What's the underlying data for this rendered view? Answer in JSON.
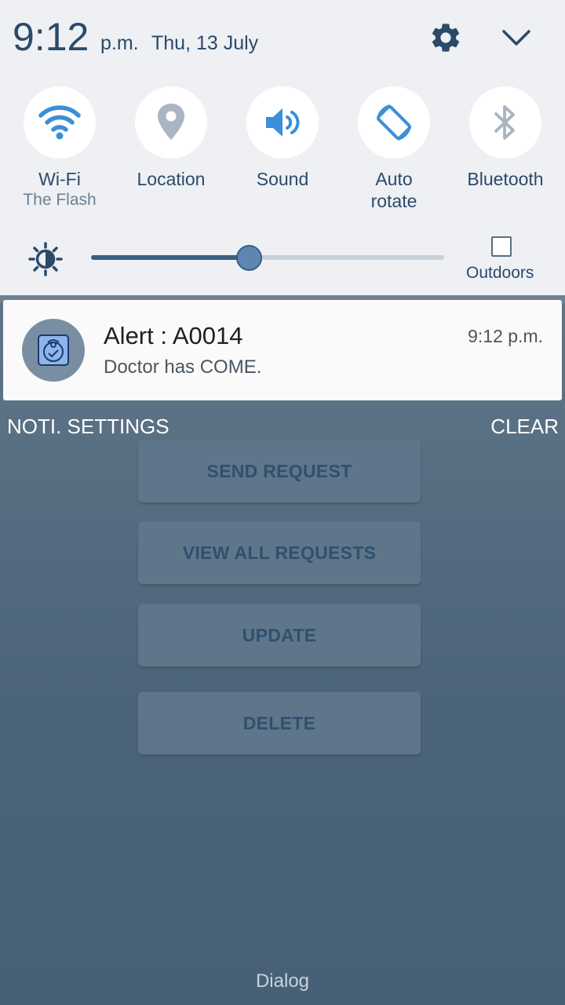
{
  "status": {
    "time": "9:12",
    "ampm": "p.m.",
    "date": "Thu, 13 July"
  },
  "quick_settings": [
    {
      "label": "Wi-Fi",
      "sub": "The Flash",
      "icon": "wifi-icon"
    },
    {
      "label": "Location",
      "sub": "",
      "icon": "location-icon"
    },
    {
      "label": "Sound",
      "sub": "",
      "icon": "sound-icon"
    },
    {
      "label": "Auto\nrotate",
      "sub": "",
      "icon": "rotate-icon"
    },
    {
      "label": "Bluetooth",
      "sub": "",
      "icon": "bluetooth-icon"
    }
  ],
  "brightness": {
    "level": 0.39,
    "outdoors_label": "Outdoors"
  },
  "notification": {
    "title": "Alert : A0014",
    "body": "Doctor has COME.",
    "time": "9:12 p.m."
  },
  "actions": {
    "settings": "NOTI. SETTINGS",
    "clear": "CLEAR"
  },
  "app": {
    "buttons": [
      "SEND REQUEST",
      "VIEW ALL REQUESTS",
      "UPDATE",
      "DELETE"
    ],
    "footer": "Dialog"
  },
  "colors": {
    "accent": "#3a5e82",
    "icon_blue": "#3b8fd9",
    "icon_grey": "#a9b5c1"
  }
}
